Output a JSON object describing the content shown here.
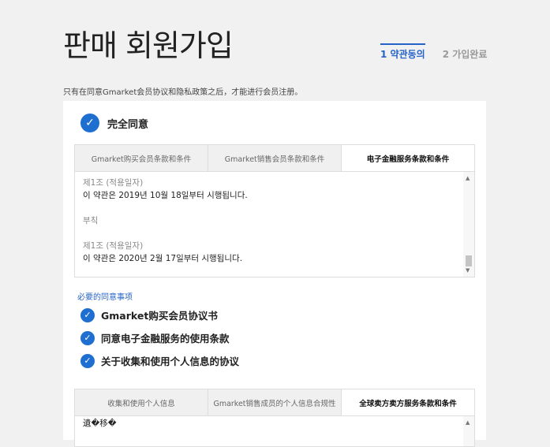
{
  "header": {
    "title": "판매 회원가입",
    "steps": [
      {
        "label": "1 약관동의",
        "active": true
      },
      {
        "label": "2 가입완료",
        "active": false
      }
    ]
  },
  "notice": "只有在同意Gmarket会员协议和隐私政策之后，才能进行会员注册。",
  "agree_all": {
    "label": "完全同意",
    "checked": true
  },
  "terms_tabs": [
    {
      "label": "Gmarket购买会员条款和条件",
      "active": false
    },
    {
      "label": "Gmarket销售会员条款和条件",
      "active": false
    },
    {
      "label": "电子金融服务条款和条件",
      "active": true
    }
  ],
  "terms_content": {
    "article1_title": "제1조 (적용일자)",
    "article1_text": "이 약관은 2019년 10월 18일부터 시행됩니다.",
    "supplement": "부칙",
    "article2_title": "제1조 (적용일자)",
    "article2_text": "이 약관은 2020년 2월 17일부터 시행됩니다."
  },
  "required_section": {
    "title": "必要的同意事项",
    "items": [
      {
        "label": "Gmarket购买会员协议书",
        "checked": true
      },
      {
        "label": "同意电子金融服务的使用条款",
        "checked": true
      },
      {
        "label": "关于收集和使用个人信息的协议",
        "checked": true
      }
    ]
  },
  "privacy_tabs": [
    {
      "label": "收集和使用个人信息",
      "active": false
    },
    {
      "label": "Gmarket销售成员的个人信息合规性",
      "active": false
    },
    {
      "label": "全球卖方卖方服务条款和条件",
      "active": true
    }
  ],
  "privacy_content": {
    "first_line": "遺�移�"
  },
  "colors": {
    "accent": "#1e6fd0",
    "link": "#2563c9",
    "background": "#f1f1f1"
  }
}
